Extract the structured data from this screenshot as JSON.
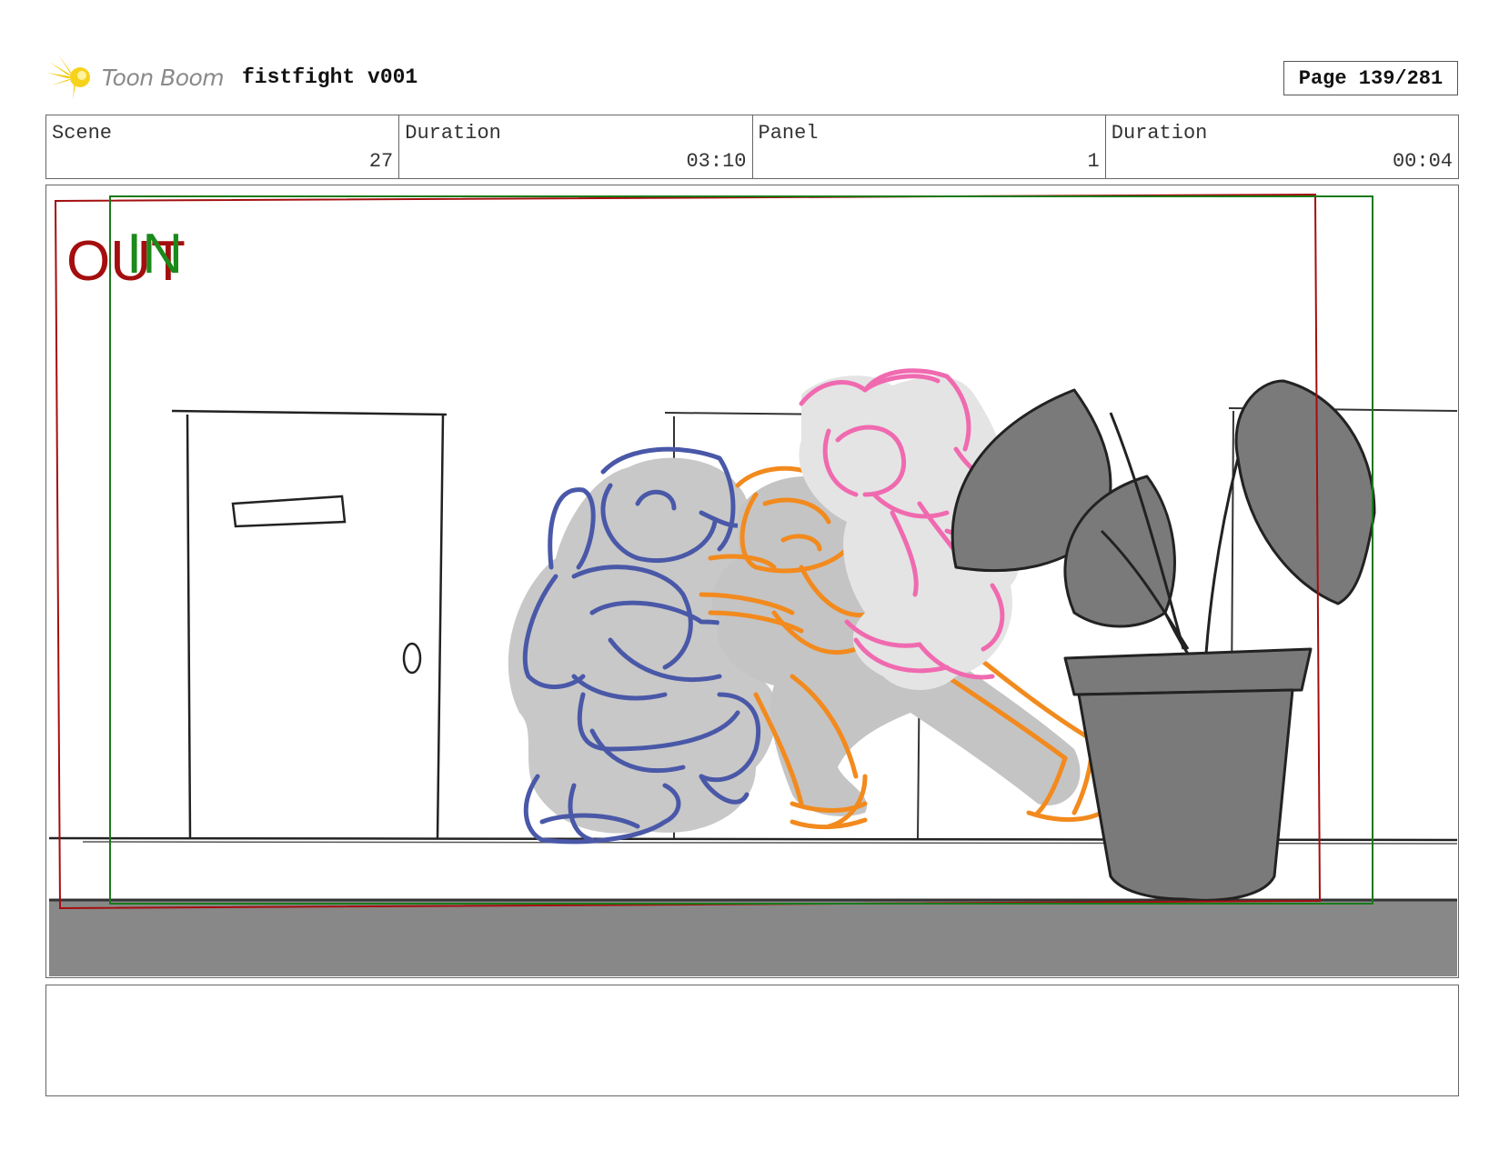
{
  "header": {
    "brand": "Toon Boom",
    "title": "fistfight v001",
    "page": "Page 139/281"
  },
  "info": {
    "scene_label": "Scene",
    "scene_value": "27",
    "scene_duration_label": "Duration",
    "scene_duration_value": "03:10",
    "panel_label": "Panel",
    "panel_value": "1",
    "panel_duration_label": "Duration",
    "panel_duration_value": "00:04"
  },
  "panel": {
    "out_label": "OUT",
    "in_label": "IN",
    "out_color": "#a40e0e",
    "in_color": "#1a8a1a"
  },
  "notes": {
    "text": ""
  }
}
